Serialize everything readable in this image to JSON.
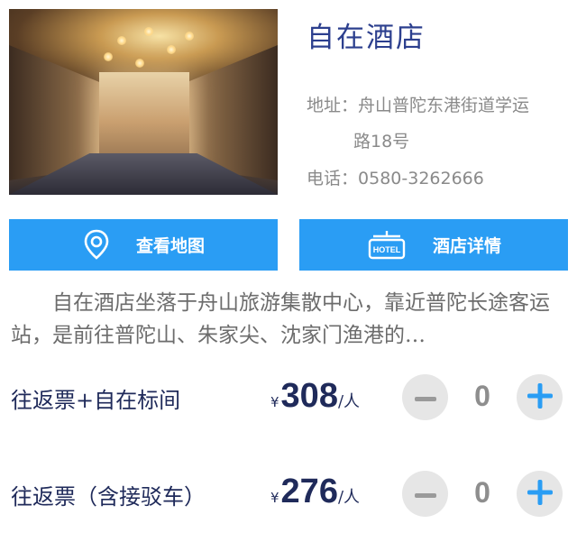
{
  "hotel": {
    "name": "自在酒店",
    "address_label": "地址：",
    "address_line1": "舟山普陀东港街道学运",
    "address_line2": "路18号",
    "phone_label": "电话：",
    "phone": "0580-3262666"
  },
  "buttons": {
    "map_label": "查看地图",
    "detail_label": "酒店详情",
    "hotel_sign_text": "HOTEL"
  },
  "description": "自在酒店坐落于舟山旅游集散中心，靠近普陀长途客运站，是前往普陀山、朱家尖、沈家门渔港的…",
  "tickets": [
    {
      "name": "往返票+自在标间",
      "currency": "¥",
      "price": "308",
      "unit": "/人",
      "quantity": "0"
    },
    {
      "name": "往返票（含接驳车）",
      "currency": "¥",
      "price": "276",
      "unit": "/人",
      "quantity": "0"
    }
  ],
  "colors": {
    "accent_blue": "#2a9df4",
    "title_blue": "#2c3f8e",
    "text_dark": "#1f2a5a",
    "text_gray": "#8a8a8a"
  }
}
